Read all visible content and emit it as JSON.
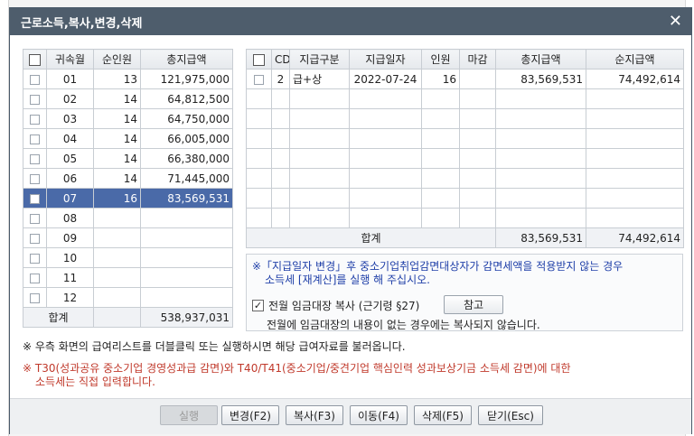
{
  "window": {
    "title": "근로소득,복사,변경,삭제",
    "close": "✕"
  },
  "left_table": {
    "headers": [
      "",
      "귀속월",
      "순인원",
      "총지급액"
    ],
    "rows": [
      {
        "month": "01",
        "count": "13",
        "amount": "121,975,000"
      },
      {
        "month": "02",
        "count": "14",
        "amount": "64,812,500"
      },
      {
        "month": "03",
        "count": "14",
        "amount": "64,750,000"
      },
      {
        "month": "04",
        "count": "14",
        "amount": "66,005,000"
      },
      {
        "month": "05",
        "count": "14",
        "amount": "66,380,000"
      },
      {
        "month": "06",
        "count": "14",
        "amount": "71,445,000"
      },
      {
        "month": "07",
        "count": "16",
        "amount": "83,569,531"
      },
      {
        "month": "08",
        "count": "",
        "amount": ""
      },
      {
        "month": "09",
        "count": "",
        "amount": ""
      },
      {
        "month": "10",
        "count": "",
        "amount": ""
      },
      {
        "month": "11",
        "count": "",
        "amount": ""
      },
      {
        "month": "12",
        "count": "",
        "amount": ""
      }
    ],
    "selected_index": 6,
    "total_label": "합계",
    "total_amount": "538,937,031"
  },
  "right_table": {
    "headers": [
      "",
      "CD",
      "지급구분",
      "지급일자",
      "인원",
      "마감",
      "총지급액",
      "순지급액"
    ],
    "row": {
      "cd": "2",
      "type": "급+상",
      "date": "2022-07-24",
      "count": "16",
      "closed": "",
      "total": "83,569,531",
      "net": "74,492,614"
    },
    "total_label": "합계",
    "total_total": "83,569,531",
    "total_net": "74,492,614"
  },
  "notice": {
    "line1": "※「지급일자 변경」후 중소기업취업감면대상자가 감면세액을 적용받지 않는 경우",
    "line2": "소득세 [재계산]를 실행 해 주십시오.",
    "copy_label": "전월 임금대장 복사 (근기령 §27)",
    "checked_mark": "✓",
    "ref_button": "참고",
    "copy_note": "전월에 임금대장의 내용이 없는 경우에는 복사되지 않습니다."
  },
  "info1": "※ 우측 화면의 급여리스트를 더블클릭 또는 실행하시면 해당 급여자료를 불러옵니다.",
  "info2_line1": "※ T30(성과공유 중소기업 경영성과급 감면)와 T40/T41(중소기업/중견기업 핵심인력 성과보상기금 소득세 감면)에 대한",
  "info2_line2": "소득세는 직접 입력합니다.",
  "buttons": {
    "execute": "실행",
    "change": "변경(F2)",
    "copy": "복사(F3)",
    "move": "이동(F4)",
    "delete": "삭제(F5)",
    "close": "닫기(Esc)"
  }
}
